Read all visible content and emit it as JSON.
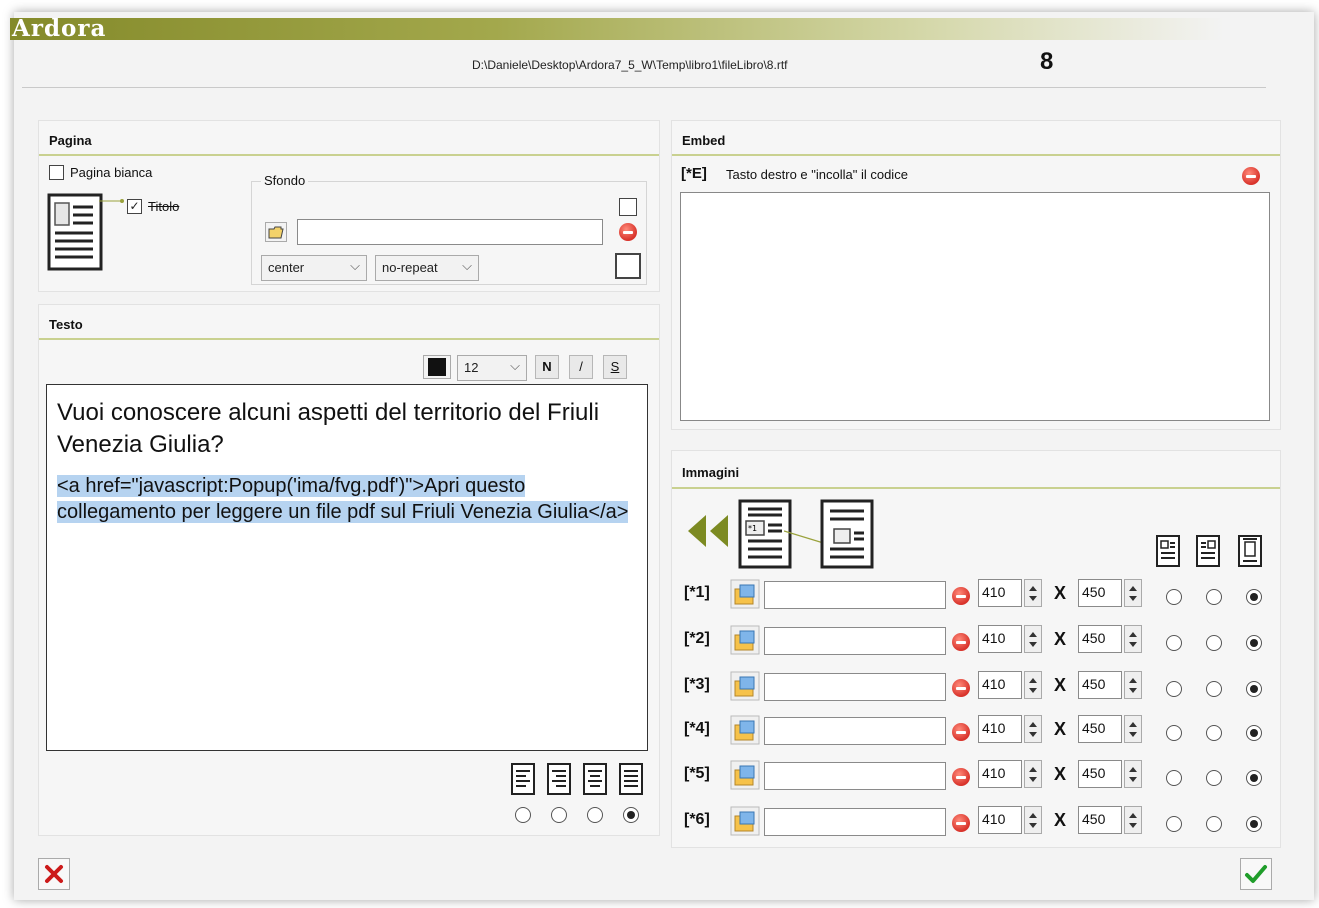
{
  "app": {
    "name": "Ardora",
    "file_path": "D:\\Daniele\\Desktop\\Ardora7_5_W\\Temp\\libro1\\fileLibro\\8.rtf",
    "page_number": "8"
  },
  "pagina": {
    "title": "Pagina",
    "blank_page_label": "Pagina bianca",
    "blank_page_checked": false,
    "title_checkbox_label": "Titolo",
    "title_checkbox_checked": true,
    "sfondo": {
      "label": "Sfondo",
      "file_value": "",
      "position_value": "center",
      "repeat_value": "no-repeat",
      "color_checkbox_checked": false
    }
  },
  "testo": {
    "title": "Testo",
    "font_size": "12",
    "bold_label": "N",
    "italic_label": "/",
    "strike_label": "S",
    "content_heading": "Vuoi conoscere alcuni aspetti del territorio del Friuli Venezia Giulia?",
    "content_link_code": "<a href=\"javascript:Popup('ima/fvg.pdf')\">Apri questo collegamento per leggere un file pdf sul Friuli Venezia Giulia</a>",
    "alignment_selected_index": 3
  },
  "embed": {
    "title": "Embed",
    "tag": "[*E]",
    "hint": "Tasto destro e \"incolla\" il codice",
    "code_value": ""
  },
  "immagini": {
    "title": "Immagini",
    "rows": [
      {
        "label": "[*1]",
        "file": "",
        "width": "410",
        "height": "450",
        "align_selected": 2
      },
      {
        "label": "[*2]",
        "file": "",
        "width": "410",
        "height": "450",
        "align_selected": 2
      },
      {
        "label": "[*3]",
        "file": "",
        "width": "410",
        "height": "450",
        "align_selected": 2
      },
      {
        "label": "[*4]",
        "file": "",
        "width": "410",
        "height": "450",
        "align_selected": 2
      },
      {
        "label": "[*5]",
        "file": "",
        "width": "410",
        "height": "450",
        "align_selected": 2
      },
      {
        "label": "[*6]",
        "file": "",
        "width": "410",
        "height": "450",
        "align_selected": 2
      }
    ],
    "times_symbol": "X",
    "first_marker": "*1"
  },
  "colors": {
    "brand": "#8a8f2e",
    "accent_rule": "#c9d190",
    "selection": "#b6d3f0",
    "cancel": "#cc1a1a",
    "confirm": "#1f9d2a"
  },
  "icons": {
    "back": "double-chevron-left-icon",
    "folder": "folder-open-icon",
    "image_file": "image-file-icon",
    "remove": "minus-circle-icon",
    "cancel": "close-x-icon",
    "confirm": "checkmark-icon"
  }
}
